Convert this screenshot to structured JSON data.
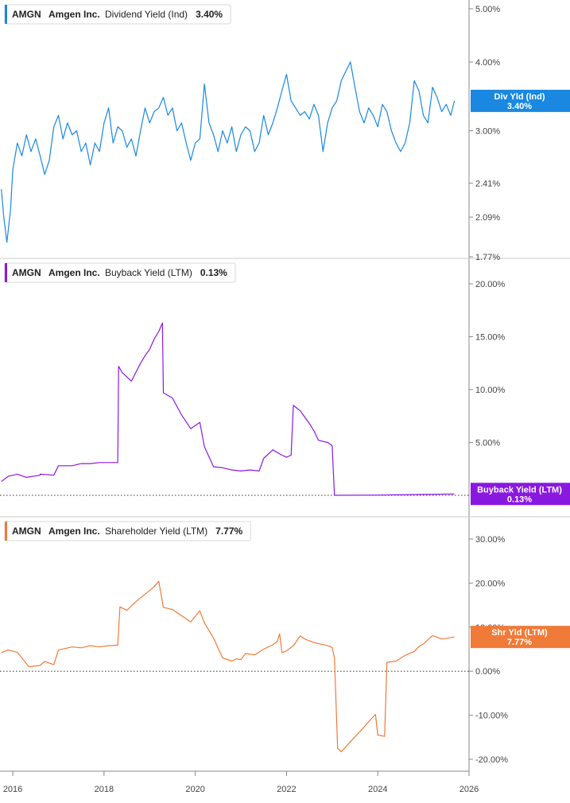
{
  "chart_data": [
    {
      "type": "line",
      "id": "dividend",
      "legend": {
        "ticker": "AMGN",
        "company": "Amgen Inc.",
        "metric": "Dividend Yield (Ind)",
        "value": "3.40%"
      },
      "tag": {
        "label": "Div Yld (Ind)",
        "value": "3.40%"
      },
      "color": "#1a88e0",
      "y_scale": "log",
      "ylim": [
        1.77,
        5.0
      ],
      "y_ticks": [
        {
          "value": 5.0,
          "label": "5.00%"
        },
        {
          "value": 4.0,
          "label": "4.00%"
        },
        {
          "value": 3.0,
          "label": "3.00%"
        },
        {
          "value": 2.41,
          "label": "2.41%"
        },
        {
          "value": 2.09,
          "label": "2.09%"
        },
        {
          "value": 1.77,
          "label": "1.77%"
        }
      ],
      "last_value": 3.4,
      "series": [
        {
          "points": [
            [
              2015.75,
              2.35
            ],
            [
              2015.8,
              2.1
            ],
            [
              2015.87,
              1.88
            ],
            [
              2015.95,
              2.15
            ],
            [
              2016.0,
              2.55
            ],
            [
              2016.1,
              2.85
            ],
            [
              2016.2,
              2.7
            ],
            [
              2016.3,
              2.95
            ],
            [
              2016.4,
              2.75
            ],
            [
              2016.5,
              2.9
            ],
            [
              2016.6,
              2.7
            ],
            [
              2016.7,
              2.5
            ],
            [
              2016.8,
              2.65
            ],
            [
              2016.9,
              3.05
            ],
            [
              2017.0,
              3.2
            ],
            [
              2017.1,
              2.9
            ],
            [
              2017.2,
              3.1
            ],
            [
              2017.3,
              2.95
            ],
            [
              2017.4,
              3.0
            ],
            [
              2017.5,
              2.75
            ],
            [
              2017.6,
              2.85
            ],
            [
              2017.7,
              2.6
            ],
            [
              2017.8,
              2.85
            ],
            [
              2017.9,
              2.75
            ],
            [
              2018.0,
              3.1
            ],
            [
              2018.1,
              3.3
            ],
            [
              2018.2,
              2.85
            ],
            [
              2018.3,
              3.05
            ],
            [
              2018.4,
              3.0
            ],
            [
              2018.5,
              2.8
            ],
            [
              2018.6,
              2.9
            ],
            [
              2018.7,
              2.7
            ],
            [
              2018.8,
              3.0
            ],
            [
              2018.9,
              3.3
            ],
            [
              2019.0,
              3.1
            ],
            [
              2019.1,
              3.25
            ],
            [
              2019.2,
              3.3
            ],
            [
              2019.3,
              3.45
            ],
            [
              2019.4,
              3.2
            ],
            [
              2019.5,
              3.3
            ],
            [
              2019.6,
              3.0
            ],
            [
              2019.7,
              3.1
            ],
            [
              2019.8,
              2.85
            ],
            [
              2019.9,
              2.65
            ],
            [
              2020.0,
              2.85
            ],
            [
              2020.1,
              2.9
            ],
            [
              2020.2,
              3.65
            ],
            [
              2020.3,
              3.1
            ],
            [
              2020.4,
              2.95
            ],
            [
              2020.5,
              2.75
            ],
            [
              2020.6,
              3.0
            ],
            [
              2020.7,
              2.85
            ],
            [
              2020.8,
              3.05
            ],
            [
              2020.9,
              2.75
            ],
            [
              2021.0,
              2.95
            ],
            [
              2021.1,
              3.05
            ],
            [
              2021.2,
              3.0
            ],
            [
              2021.3,
              2.75
            ],
            [
              2021.4,
              2.85
            ],
            [
              2021.5,
              3.2
            ],
            [
              2021.6,
              2.95
            ],
            [
              2021.7,
              3.1
            ],
            [
              2021.8,
              3.3
            ],
            [
              2021.9,
              3.55
            ],
            [
              2022.0,
              3.8
            ],
            [
              2022.1,
              3.4
            ],
            [
              2022.2,
              3.3
            ],
            [
              2022.3,
              3.2
            ],
            [
              2022.4,
              3.25
            ],
            [
              2022.5,
              3.15
            ],
            [
              2022.6,
              3.35
            ],
            [
              2022.7,
              3.2
            ],
            [
              2022.8,
              2.75
            ],
            [
              2022.9,
              3.1
            ],
            [
              2023.0,
              3.3
            ],
            [
              2023.1,
              3.4
            ],
            [
              2023.2,
              3.7
            ],
            [
              2023.3,
              3.85
            ],
            [
              2023.4,
              4.0
            ],
            [
              2023.5,
              3.6
            ],
            [
              2023.6,
              3.25
            ],
            [
              2023.7,
              3.1
            ],
            [
              2023.8,
              3.3
            ],
            [
              2023.9,
              3.2
            ],
            [
              2024.0,
              3.05
            ],
            [
              2024.1,
              3.35
            ],
            [
              2024.2,
              3.25
            ],
            [
              2024.3,
              3.0
            ],
            [
              2024.4,
              2.85
            ],
            [
              2024.5,
              2.75
            ],
            [
              2024.6,
              2.85
            ],
            [
              2024.7,
              3.1
            ],
            [
              2024.8,
              3.7
            ],
            [
              2024.9,
              3.55
            ],
            [
              2025.0,
              3.2
            ],
            [
              2025.1,
              3.1
            ],
            [
              2025.2,
              3.6
            ],
            [
              2025.3,
              3.45
            ],
            [
              2025.4,
              3.25
            ],
            [
              2025.5,
              3.35
            ],
            [
              2025.6,
              3.2
            ],
            [
              2025.68,
              3.4
            ]
          ]
        }
      ]
    },
    {
      "type": "line",
      "id": "buyback",
      "legend": {
        "ticker": "AMGN",
        "company": "Amgen Inc.",
        "metric": "Buyback Yield (LTM)",
        "value": "0.13%"
      },
      "tag": {
        "label": "Buyback Yield (LTM)",
        "value": "0.13%"
      },
      "color": "#8a19e0",
      "y_scale": "linear",
      "ylim": [
        0,
        20
      ],
      "y_ticks": [
        {
          "value": 20,
          "label": "20.00%"
        },
        {
          "value": 15,
          "label": "15.00%"
        },
        {
          "value": 10,
          "label": "10.00%"
        },
        {
          "value": 5,
          "label": "5.00%"
        }
      ],
      "zero_line": true,
      "last_value": 0.13,
      "series": [
        {
          "points": [
            [
              2015.75,
              1.3
            ],
            [
              2015.9,
              1.8
            ],
            [
              2016.1,
              2.0
            ],
            [
              2016.3,
              1.7
            ],
            [
              2016.6,
              1.9
            ],
            [
              2016.6,
              2.0
            ],
            [
              2016.9,
              1.9
            ],
            [
              2017.0,
              2.8
            ],
            [
              2017.3,
              2.8
            ],
            [
              2017.5,
              3.0
            ],
            [
              2017.7,
              3.0
            ],
            [
              2017.9,
              3.1
            ],
            [
              2018.1,
              3.1
            ],
            [
              2018.3,
              3.1
            ],
            [
              2018.32,
              12.2
            ],
            [
              2018.4,
              11.6
            ],
            [
              2018.6,
              10.8
            ],
            [
              2018.8,
              12.5
            ],
            [
              2018.9,
              13.2
            ],
            [
              2019.0,
              13.8
            ],
            [
              2019.1,
              14.8
            ],
            [
              2019.2,
              15.5
            ],
            [
              2019.28,
              16.3
            ],
            [
              2019.3,
              9.7
            ],
            [
              2019.5,
              9.2
            ],
            [
              2019.7,
              7.6
            ],
            [
              2019.9,
              6.3
            ],
            [
              2020.1,
              6.9
            ],
            [
              2020.2,
              4.6
            ],
            [
              2020.4,
              2.7
            ],
            [
              2020.6,
              2.6
            ],
            [
              2020.8,
              2.4
            ],
            [
              2021.0,
              2.3
            ],
            [
              2021.2,
              2.4
            ],
            [
              2021.4,
              2.3
            ],
            [
              2021.5,
              3.5
            ],
            [
              2021.7,
              4.3
            ],
            [
              2021.9,
              3.8
            ],
            [
              2022.0,
              3.6
            ],
            [
              2022.1,
              3.8
            ],
            [
              2022.15,
              8.5
            ],
            [
              2022.3,
              8.0
            ],
            [
              2022.5,
              6.8
            ],
            [
              2022.6,
              6.1
            ],
            [
              2022.7,
              5.2
            ],
            [
              2022.9,
              5.0
            ],
            [
              2023.0,
              4.7
            ],
            [
              2023.05,
              0.0
            ],
            [
              2024.0,
              0.02
            ],
            [
              2025.0,
              0.08
            ],
            [
              2025.68,
              0.13
            ]
          ]
        }
      ]
    },
    {
      "type": "line",
      "id": "shareholder",
      "legend": {
        "ticker": "AMGN",
        "company": "Amgen Inc.",
        "metric": "Shareholder Yield (LTM)",
        "value": "7.77%"
      },
      "tag": {
        "label": "Shr Yld (LTM)",
        "value": "7.77%"
      },
      "color": "#f07a38",
      "y_scale": "linear",
      "ylim": [
        -20,
        30
      ],
      "y_ticks": [
        {
          "value": 30,
          "label": "30.00%"
        },
        {
          "value": 20,
          "label": "20.00%"
        },
        {
          "value": 10,
          "label": "10.00%"
        },
        {
          "value": 0,
          "label": "0.00%"
        },
        {
          "value": -10,
          "label": "-10.00%"
        },
        {
          "value": -20,
          "label": "-20.00%"
        }
      ],
      "zero_line": true,
      "last_value": 7.77,
      "series": [
        {
          "points": [
            [
              2015.75,
              4.2
            ],
            [
              2015.9,
              4.8
            ],
            [
              2016.1,
              4.3
            ],
            [
              2016.3,
              1.7
            ],
            [
              2016.35,
              1.0
            ],
            [
              2016.6,
              1.3
            ],
            [
              2016.7,
              2.2
            ],
            [
              2016.9,
              1.5
            ],
            [
              2017.0,
              4.8
            ],
            [
              2017.3,
              5.5
            ],
            [
              2017.5,
              5.3
            ],
            [
              2017.7,
              5.8
            ],
            [
              2017.9,
              5.5
            ],
            [
              2018.1,
              5.8
            ],
            [
              2018.3,
              5.9
            ],
            [
              2018.35,
              14.6
            ],
            [
              2018.5,
              13.8
            ],
            [
              2018.7,
              15.8
            ],
            [
              2018.9,
              17.5
            ],
            [
              2019.0,
              18.3
            ],
            [
              2019.1,
              19.2
            ],
            [
              2019.2,
              20.4
            ],
            [
              2019.3,
              14.5
            ],
            [
              2019.5,
              14.0
            ],
            [
              2019.7,
              12.6
            ],
            [
              2019.9,
              11.2
            ],
            [
              2020.1,
              13.7
            ],
            [
              2020.2,
              11.0
            ],
            [
              2020.4,
              7.5
            ],
            [
              2020.6,
              3.0
            ],
            [
              2020.8,
              2.3
            ],
            [
              2020.9,
              2.8
            ],
            [
              2021.0,
              2.6
            ],
            [
              2021.1,
              4.0
            ],
            [
              2021.3,
              3.7
            ],
            [
              2021.5,
              5.0
            ],
            [
              2021.7,
              6.0
            ],
            [
              2021.8,
              6.8
            ],
            [
              2021.85,
              8.5
            ],
            [
              2021.9,
              4.2
            ],
            [
              2022.0,
              4.6
            ],
            [
              2022.15,
              5.8
            ],
            [
              2022.3,
              8.0
            ],
            [
              2022.4,
              7.3
            ],
            [
              2022.6,
              6.5
            ],
            [
              2022.9,
              5.8
            ],
            [
              2023.0,
              5.4
            ],
            [
              2023.05,
              3.0
            ],
            [
              2023.12,
              -17.5
            ],
            [
              2023.2,
              -18.3
            ],
            [
              2023.4,
              -16.0
            ],
            [
              2023.6,
              -13.8
            ],
            [
              2023.8,
              -11.5
            ],
            [
              2023.95,
              -9.8
            ],
            [
              2024.0,
              -14.5
            ],
            [
              2024.15,
              -14.8
            ],
            [
              2024.2,
              2.0
            ],
            [
              2024.4,
              2.3
            ],
            [
              2024.6,
              3.6
            ],
            [
              2024.8,
              4.5
            ],
            [
              2024.9,
              5.6
            ],
            [
              2025.0,
              6.2
            ],
            [
              2025.2,
              8.1
            ],
            [
              2025.4,
              7.3
            ],
            [
              2025.68,
              7.77
            ]
          ]
        }
      ]
    }
  ],
  "x_axis": {
    "ticks": [
      {
        "value": 2016,
        "label": "2016"
      },
      {
        "value": 2018,
        "label": "2018"
      },
      {
        "value": 2020,
        "label": "2020"
      },
      {
        "value": 2022,
        "label": "2022"
      },
      {
        "value": 2024,
        "label": "2024"
      },
      {
        "value": 2026,
        "label": "2026"
      }
    ],
    "xlim": [
      2015.72,
      2026
    ]
  },
  "grid": false,
  "legend_position": "top-left"
}
